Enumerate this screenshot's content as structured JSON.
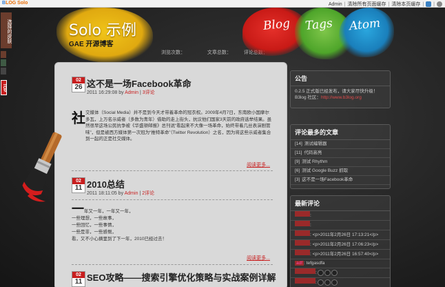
{
  "admin_bar": {
    "logo_b": "B",
    "logo_rest": "LOG Solo",
    "links": [
      "Admin",
      "清除所有页面缓存",
      "清除本页缓存"
    ]
  },
  "left_tabs": {
    "theme_tab": "选择的皮肤",
    "top_tab": "TOP"
  },
  "header": {
    "title": "Solo 示例",
    "subtitle": "GAE 开源博客",
    "stats": {
      "visits_label": "浏览次数：",
      "visits_value": "",
      "articles_label": "文章总数：",
      "articles_value": "",
      "comments_label": "评论总数："
    },
    "nav": [
      "Blog",
      "Tags",
      "Atom"
    ]
  },
  "posts": [
    {
      "month": "02",
      "day": "26",
      "title": "这不是一场Facebook革命",
      "meta_time": "2011 16:29:08 by ",
      "author": "Admin",
      "comments": "3评论",
      "dropcap": "社",
      "text": "交媒体（Social Media）并不是到今天才带着革命的冠衣权。2009年4月7日，东南欧小国摩尔多瓦，上万名示威者（多数为青年）借助的走上街头，抗议他们国家3天前的政府选举结果。虽然很早这场公民抗争被《华盛顿邮报》总刊说“看起来不大像一场革命，始终带着几丝表演剧管味”，但是被西方媒体第一次冠为“推特革命”（Twitter Revolution）之名，因为将这些示威者集合到一起的正是社交媒体。",
      "more": "阅读更多..."
    },
    {
      "month": "02",
      "day": "11",
      "title": "2010总结",
      "meta_time": "2011 18:11:05 by ",
      "author": "Admin",
      "comments": "2评论",
      "dropcap": "一",
      "lines": [
        "年又一年，一年又一年，",
        "一些理想，一些故事，",
        "一些回忆，一些事情，",
        "一些是非，一些感慨，",
        "看，又不小心摘里到了下一年，2010已经过去！"
      ],
      "more": "阅读更多..."
    },
    {
      "month": "02",
      "day": "11",
      "title": "SEO攻略——搜索引擎优化策略与实战案例详解"
    }
  ],
  "sidebar": {
    "notice": {
      "heading": "公告",
      "text": "0.2.5 正式版已经发布，请大家尽快升级！",
      "text2": "B3log 社区：",
      "link": "http://www.b3log.org"
    },
    "most_commented": {
      "heading": "评论最多的文章",
      "items": [
        {
          "count": "[14]",
          "title": "测试编辑器"
        },
        {
          "count": "[11]",
          "title": "代码高亮"
        },
        {
          "count": "[9]",
          "title": "测试 Rhythm"
        },
        {
          "count": "[6]",
          "title": "测试 Google Buzz 抓取"
        },
        {
          "count": "[3]",
          "title": "这不是一场Facebook革命"
        }
      ]
    },
    "recent_comments": {
      "heading": "最新评论",
      "items": [
        {
          "author": "",
          "text": ":"
        },
        {
          "author": "",
          "text": ":"
        },
        {
          "author": "",
          "text": ": <p>2011年2月26日 17:13:21</p>"
        },
        {
          "author": "",
          "text": ": <p>2011年2月26日 17:06:23</p>"
        },
        {
          "author": "",
          "text": ": <p>2011年2月26日 16:57:40</p>"
        },
        {
          "author": "adf",
          "text": ": tefgasdfa"
        },
        {
          "author": "",
          "text": ":"
        },
        {
          "author": "",
          "text": ":"
        }
      ]
    }
  },
  "colors": {
    "accent_red": "#c81e1e",
    "yellow": "#f0c419",
    "green": "#4ea52a",
    "blue": "#1a7fbb"
  }
}
